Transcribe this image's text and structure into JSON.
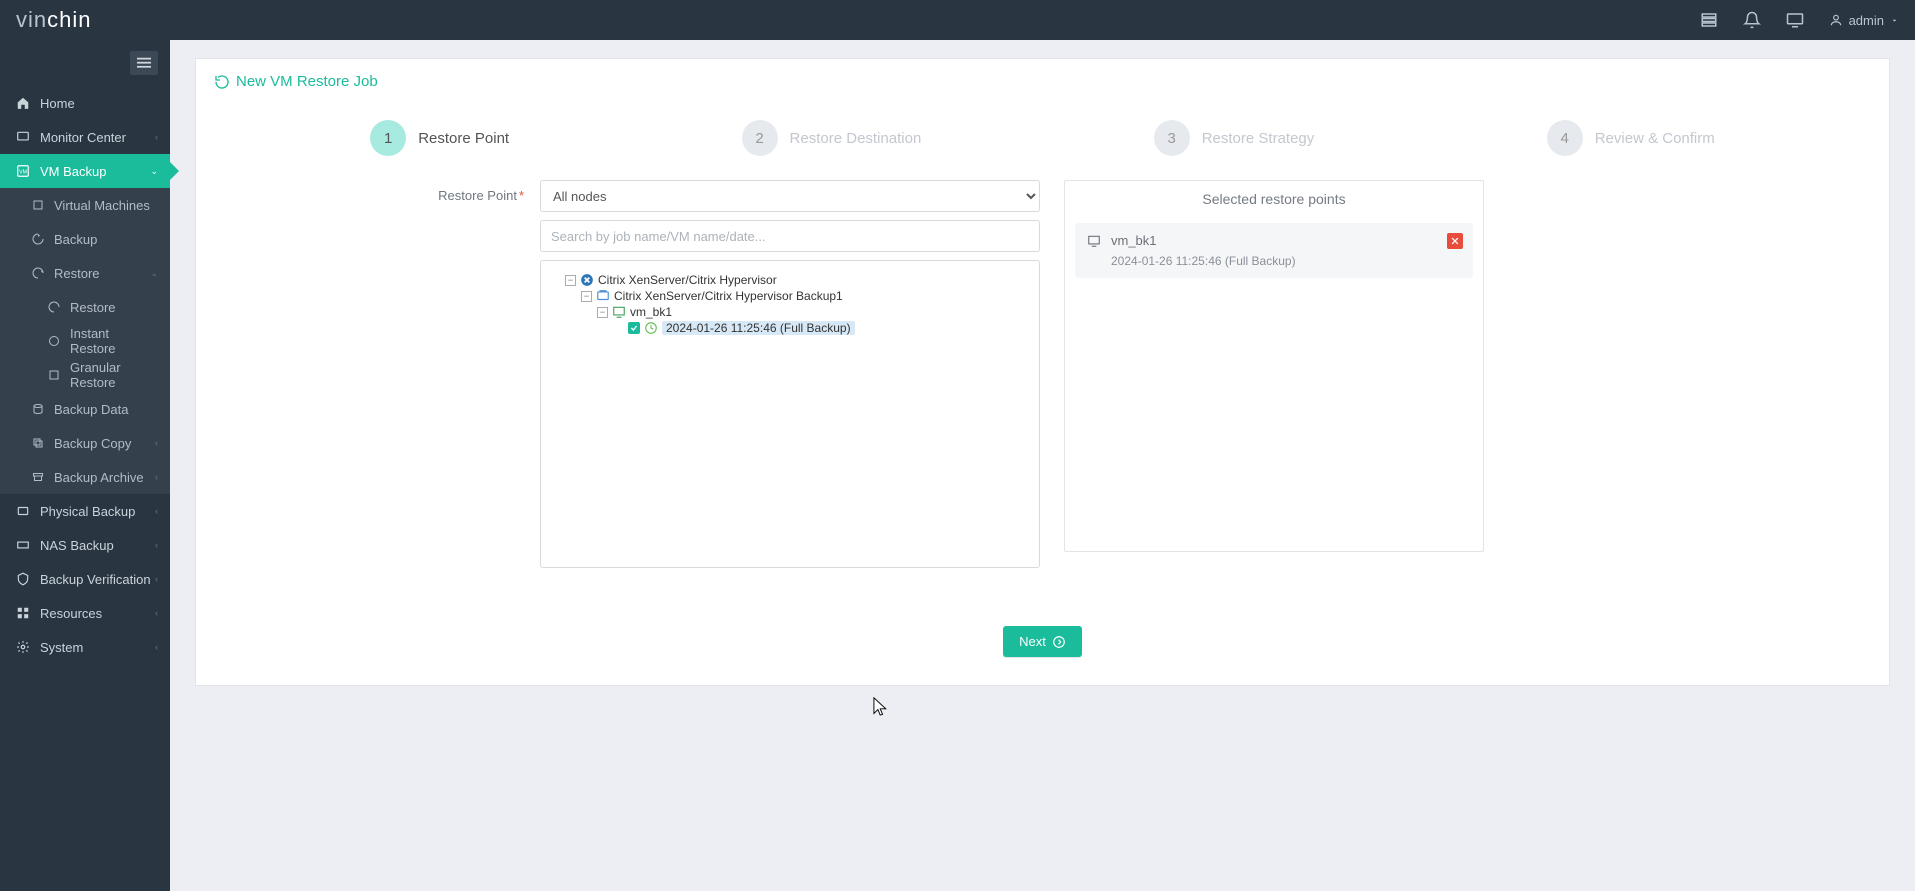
{
  "brand": {
    "part1": "vin",
    "part2": "chin"
  },
  "header": {
    "user_label": "admin"
  },
  "sidebar": {
    "items": [
      {
        "label": "Home"
      },
      {
        "label": "Monitor Center"
      },
      {
        "label": "VM Backup"
      },
      {
        "label": "Virtual Machines"
      },
      {
        "label": "Backup"
      },
      {
        "label": "Restore"
      },
      {
        "label": "Restore"
      },
      {
        "label": "Instant Restore"
      },
      {
        "label": "Granular Restore"
      },
      {
        "label": "Backup Data"
      },
      {
        "label": "Backup Copy"
      },
      {
        "label": "Backup Archive"
      },
      {
        "label": "Physical Backup"
      },
      {
        "label": "NAS Backup"
      },
      {
        "label": "Backup Verification"
      },
      {
        "label": "Resources"
      },
      {
        "label": "System"
      }
    ]
  },
  "page": {
    "title": "New VM Restore Job",
    "steps": [
      {
        "num": "1",
        "label": "Restore Point"
      },
      {
        "num": "2",
        "label": "Restore Destination"
      },
      {
        "num": "3",
        "label": "Restore Strategy"
      },
      {
        "num": "4",
        "label": "Review & Confirm"
      }
    ],
    "form_label": "Restore Point",
    "node_select": "All nodes",
    "search_placeholder": "Search by job name/VM name/date...",
    "tree": {
      "hv": "Citrix XenServer/Citrix Hypervisor",
      "job": "Citrix XenServer/Citrix Hypervisor Backup1",
      "vm": "vm_bk1",
      "point": "2024-01-26 11:25:46 (Full  Backup)"
    },
    "selected": {
      "title": "Selected restore points",
      "vm": "vm_bk1",
      "point": "2024-01-26 11:25:46 (Full Backup)"
    },
    "next_label": "Next"
  }
}
